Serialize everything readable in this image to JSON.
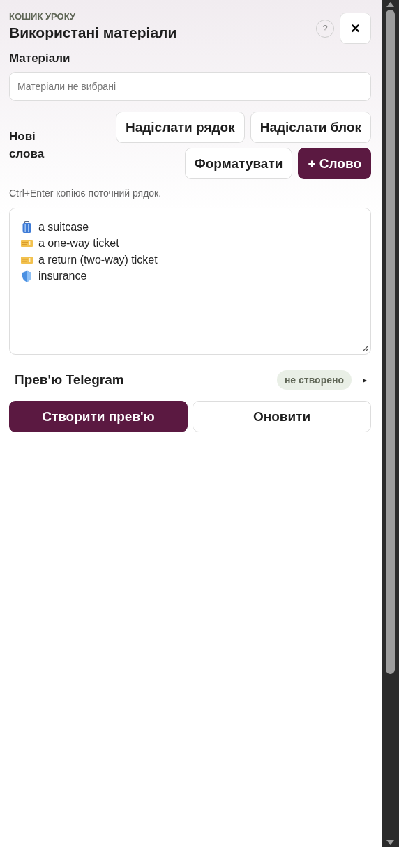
{
  "header": {
    "eyebrow": "КОШИК УРОКУ",
    "title": "Використані матеріали",
    "help": "?",
    "close": "×"
  },
  "materials": {
    "label": "Матеріали",
    "placeholder": "Матеріали не вибрані"
  },
  "new_words": {
    "label": "Нові слова",
    "buttons": [
      {
        "label": "Надіслати рядок",
        "primary": false
      },
      {
        "label": "Надіслати блок",
        "primary": false
      },
      {
        "label": "Форматувати",
        "primary": false
      },
      {
        "label": "+ Слово",
        "primary": true
      }
    ],
    "hint": "Ctrl+Enter копіює поточний рядок.",
    "lines": [
      {
        "kind": "suitcase",
        "text": "a suitcase"
      },
      {
        "kind": "ticket",
        "text": "a one-way ticket"
      },
      {
        "kind": "ticket",
        "text": "a return (two-way) ticket"
      },
      {
        "kind": "shield",
        "text": "insurance"
      }
    ]
  },
  "preview": {
    "title": "Прев'ю Telegram",
    "status": "не створено",
    "toggle": "▸",
    "expanded": false,
    "buttons": [
      {
        "label": "Створити прев'ю",
        "primary": true
      },
      {
        "label": "Оновити",
        "primary": false
      }
    ]
  }
}
